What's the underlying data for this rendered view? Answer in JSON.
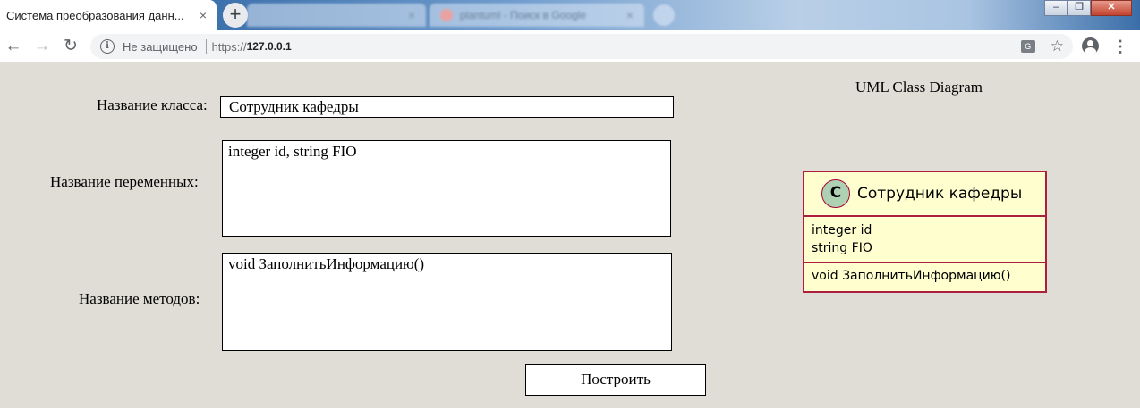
{
  "browser": {
    "active_tab": {
      "title": "Система преобразования данн...",
      "close": "×"
    },
    "new_tab": "+",
    "background_tabs": [
      {
        "title": "plantuml - Поиск в Google",
        "close": "×"
      }
    ],
    "window_controls": {
      "minimize": "‒",
      "maximize": "❐",
      "close": "✕"
    },
    "nav": {
      "back": "←",
      "forward": "→",
      "reload": "↻"
    },
    "address": {
      "security_text": "Не защищено",
      "scheme": "https://",
      "host": "127.0.0.1"
    },
    "menu": "⋮",
    "star": "☆",
    "translate": "G"
  },
  "form": {
    "class_name_label": "Название класса:",
    "class_name_value": "Сотрудник кафедры",
    "variables_label": "Название переменных:",
    "variables_value": "integer id, string FIO",
    "methods_label": "Название методов:",
    "methods_value": "void ЗаполнитьИнформацию()",
    "build_button": "Построить"
  },
  "diagram": {
    "title": "UML Class Diagram",
    "class_stereotype": "C",
    "class_name": "Сотрудник кафедры",
    "attributes": [
      "integer id",
      "string FIO"
    ],
    "operations": [
      "void ЗаполнитьИнформацию()"
    ],
    "colors": {
      "fill": "#fefecf",
      "border": "#ad1f3f",
      "circle": "#add1b2"
    }
  }
}
